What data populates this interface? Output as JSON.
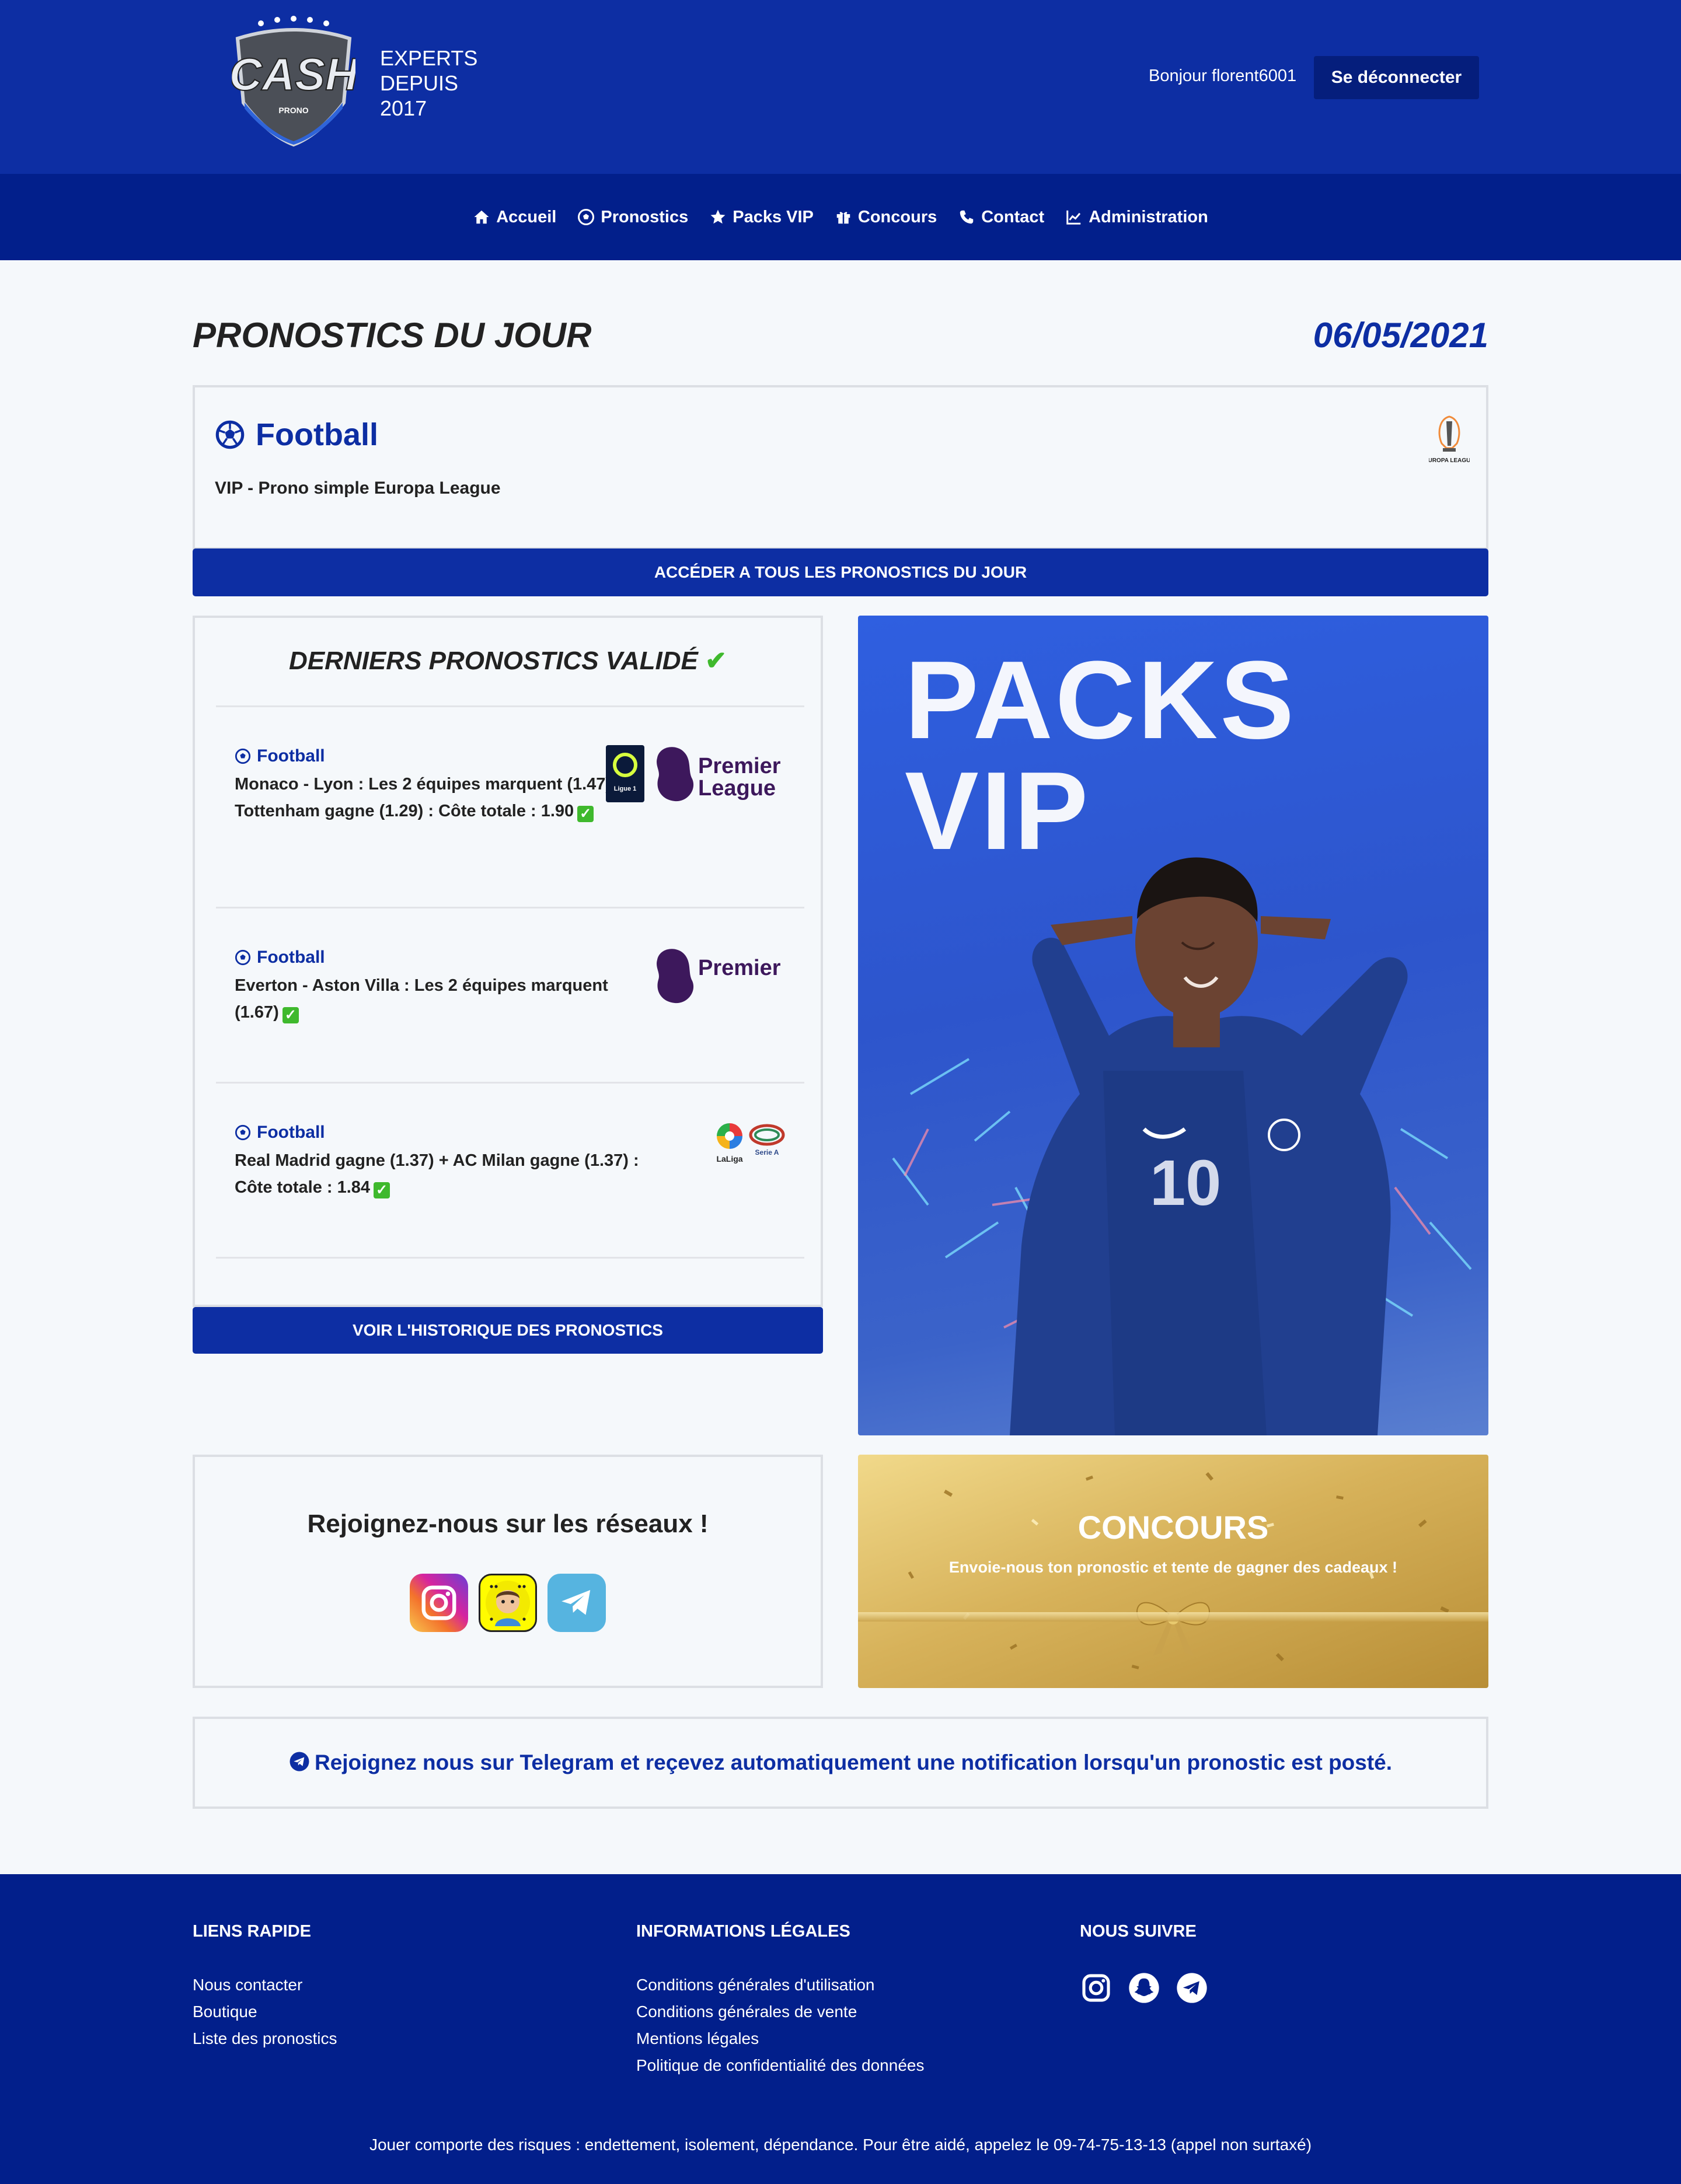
{
  "header": {
    "logo_text": "CASH",
    "logo_subtext": "PRONO",
    "tagline": [
      "EXPERTS",
      "DEPUIS",
      "2017"
    ],
    "greeting": "Bonjour florent6001",
    "logout_label": "Se déconnecter"
  },
  "nav": [
    {
      "label": "Accueil",
      "icon": "home-icon"
    },
    {
      "label": "Pronostics",
      "icon": "soccer-ball-icon"
    },
    {
      "label": "Packs VIP",
      "icon": "star-icon"
    },
    {
      "label": "Concours",
      "icon": "gift-icon"
    },
    {
      "label": "Contact",
      "icon": "phone-icon"
    },
    {
      "label": "Administration",
      "icon": "chart-icon"
    }
  ],
  "main": {
    "title": "PRONOSTICS DU JOUR",
    "date": "06/05/2021"
  },
  "today": {
    "sport": "Football",
    "description": "VIP - Prono simple Europa League",
    "competition_logo_text": "EUROPA LEAGUE",
    "button_label": "ACCÉDER A TOUS LES PRONOSTICS DU JOUR"
  },
  "validated": {
    "title": "DERNIERS PRONOSTICS VALIDÉ",
    "check": "✔",
    "items": [
      {
        "sport": "Football",
        "text": "Monaco - Lyon : Les 2 équipes marquent (1.47) + Tottenham gagne (1.29) : Côte totale : 1.90",
        "logos": [
          "Ligue 1",
          "Premier League"
        ]
      },
      {
        "sport": "Football",
        "text": "Everton - Aston Villa : Les 2 équipes marquent (1.67)",
        "logos": [
          "Premier League"
        ]
      },
      {
        "sport": "Football",
        "text": "Real Madrid gagne (1.37) + AC Milan gagne (1.37) : Côte totale : 1.84",
        "logos": [
          "LaLiga",
          "Serie A"
        ]
      }
    ],
    "ok_mark": "✓",
    "history_label": "VOIR L'HISTORIQUE DES PRONOSTICS"
  },
  "vip_banner": {
    "line1": "PACKS",
    "line2": "VIP",
    "jersey_number": "10"
  },
  "social": {
    "title": "Rejoignez-nous sur les réseaux !",
    "icons": [
      "instagram-icon",
      "snapchat-icon",
      "telegram-icon"
    ]
  },
  "contest": {
    "title": "CONCOURS",
    "subtitle": "Envoie-nous ton pronostic et tente de gagner des cadeaux !"
  },
  "telegram_notice": {
    "text": "Rejoignez nous sur Telegram et reçevez automatiquement une notification lorsqu'un pronostic est posté."
  },
  "footer": {
    "quick_links_title": "LIENS RAPIDE",
    "quick_links": [
      "Nous contacter",
      "Boutique",
      "Liste des pronostics"
    ],
    "legal_title": "INFORMATIONS LÉGALES",
    "legal_links": [
      "Conditions générales d'utilisation",
      "Conditions générales de vente",
      "Mentions légales",
      "Politique de confidentialité des données"
    ],
    "follow_title": "NOUS SUIVRE",
    "disclaimer": "Jouer comporte des risques : endettement, isolement, dépendance. Pour être aidé, appelez le 09-74-75-13-13 (appel non surtaxé)"
  },
  "colors": {
    "primary": "#0d2ea3",
    "nav_bg": "#021f8b",
    "success": "#3fb92d",
    "background": "#f5f8fb"
  }
}
